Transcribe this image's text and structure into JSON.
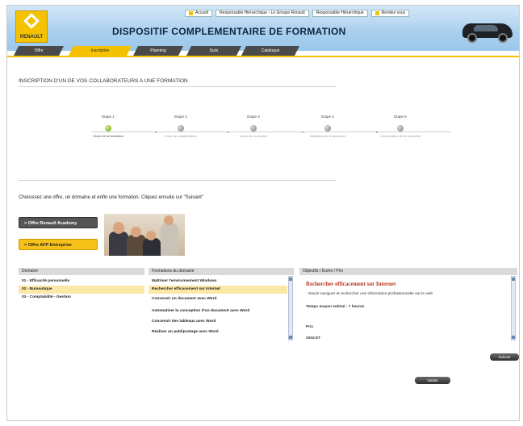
{
  "brand": {
    "logo_text": "RENAULT",
    "accent": "#f4c200",
    "dark": "#4a4a4a"
  },
  "topbar": {
    "home": "Accueil",
    "user": "Responsable Hiérarchique - Le Groupe Renault",
    "profile": "Responsable Hiérarchique",
    "extra": "Rendez-vous"
  },
  "header": {
    "title": "DISPOSITIF COMPLEMENTAIRE DE FORMATION"
  },
  "nav": {
    "tabs": [
      "Offre",
      "Inscription",
      "Planning",
      "Suivi",
      "Catalogue"
    ],
    "active_index": 1
  },
  "section_title": "INSCRIPTION D'UN DE VOS COLLABORATEURS A UNE FORMATION",
  "steps": [
    {
      "label": "Etape 1",
      "desc": "Choix de la formation",
      "active": true
    },
    {
      "label": "Etape 2",
      "desc": "Choix du collaborateur",
      "active": false
    },
    {
      "label": "Etape 3",
      "desc": "Choix de la session",
      "active": false
    },
    {
      "label": "Etape 4",
      "desc": "Validation de la demande",
      "active": false
    },
    {
      "label": "Etape 5",
      "desc": "Confirmation de la demande",
      "active": false
    }
  ],
  "instruction": "Choisissez une offre, un domaine et enfin une formation. Cliquez ensuite sur \"Suivant\"",
  "offers": {
    "academy": "> Offre Renault Academy",
    "enterprise": "> Offre AFP Entreprise"
  },
  "domains": {
    "header": "Domaine",
    "items": [
      "01 - Efficacité personnelle",
      "02 - Bureautique",
      "03 - Comptabilité - Gestion"
    ],
    "selected_index": 1
  },
  "trainings": {
    "header": "Formations du domaine",
    "items": [
      "Maîtriser l'environnement Windows",
      "Rechercher efficacement sur Internet",
      "Concevoir un document avec Word",
      "Automatiser la conception d'un document avec Word",
      "Concevoir des tableaux avec Word",
      "Réaliser un publipostage avec Word"
    ],
    "selected_index": 1
  },
  "objective": {
    "header": "Objectifs / Durée / Prix",
    "title": "Rechercher efficacement sur Internet",
    "text": "- Savoir naviguer et rechercher une information professionnelle sur le web",
    "duration_label": "Temps moyen estimé : 7 heures",
    "price_label": "Prix",
    "price_value": "1004 ET"
  },
  "buttons": {
    "next": "Suivant",
    "validate": "Valider"
  }
}
